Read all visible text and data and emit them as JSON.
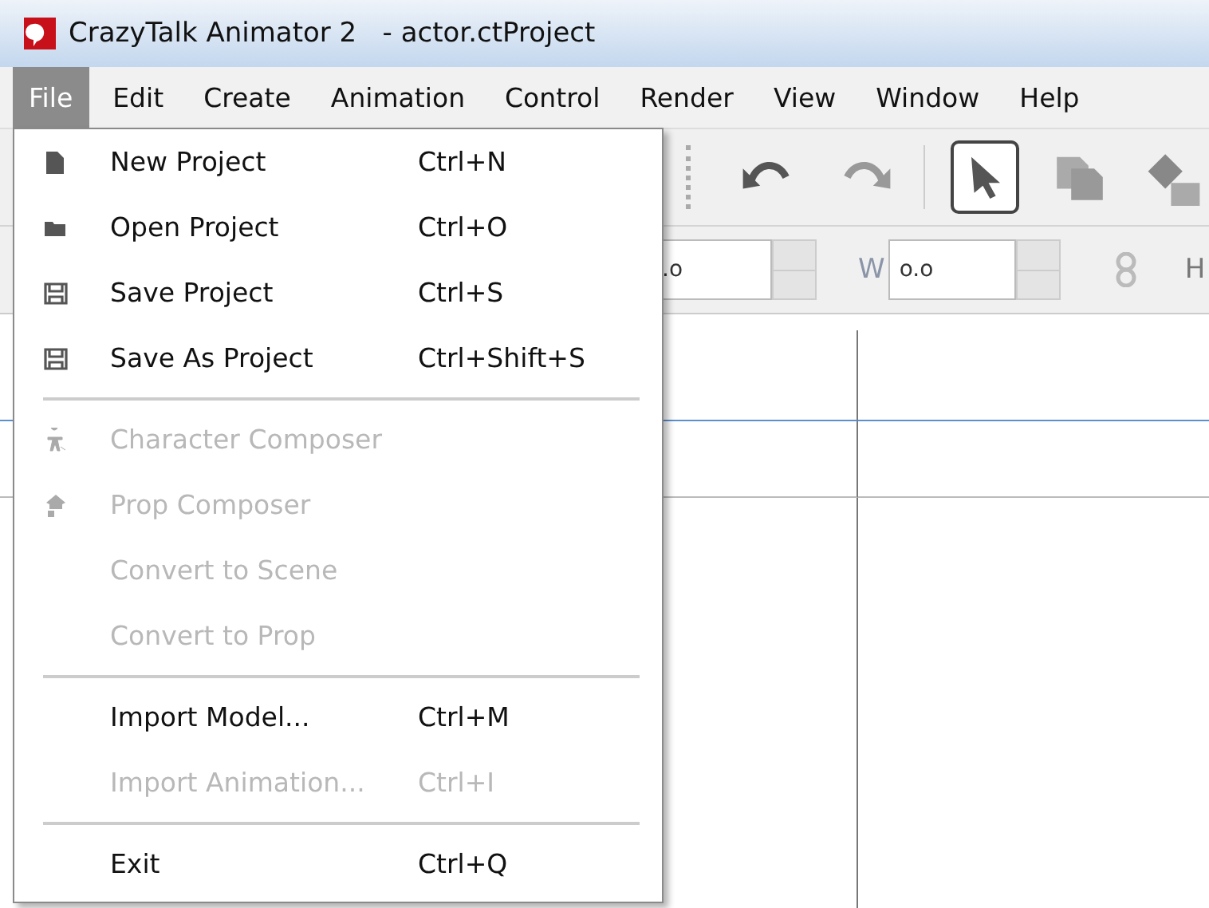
{
  "window": {
    "title": "CrazyTalk Animator 2   - actor.ctProject"
  },
  "menubar": [
    {
      "label": "File",
      "selected": true
    },
    {
      "label": "Edit",
      "selected": false
    },
    {
      "label": "Create",
      "selected": false
    },
    {
      "label": "Animation",
      "selected": false
    },
    {
      "label": "Control",
      "selected": false
    },
    {
      "label": "Render",
      "selected": false
    },
    {
      "label": "View",
      "selected": false
    },
    {
      "label": "Window",
      "selected": false
    },
    {
      "label": "Help",
      "selected": false
    }
  ],
  "toolbar": [
    {
      "kind": "undo",
      "selected": false
    },
    {
      "kind": "redo",
      "selected": false
    },
    {
      "kind": "select",
      "selected": true
    },
    {
      "kind": "copy",
      "selected": false
    },
    {
      "kind": "shape",
      "selected": false
    }
  ],
  "transform_bar": {
    "x_value": ".o",
    "w_label": "W",
    "w_value": "o.o",
    "h_label": "H"
  },
  "file_menu": {
    "sections": [
      [
        {
          "label": "New Project",
          "shortcut": "Ctrl+N",
          "kind": "page",
          "disabled": false
        },
        {
          "label": "Open Project",
          "shortcut": "Ctrl+O",
          "kind": "folder",
          "disabled": false
        },
        {
          "label": "Save Project",
          "shortcut": "Ctrl+S",
          "kind": "floppy",
          "disabled": false
        },
        {
          "label": "Save As Project",
          "shortcut": "Ctrl+Shift+S",
          "kind": "floppy",
          "disabled": false
        }
      ],
      [
        {
          "label": "Character Composer",
          "kind": "figure",
          "disabled": true
        },
        {
          "label": "Prop Composer",
          "kind": "prop",
          "disabled": true
        },
        {
          "label": "Convert to Scene",
          "kind": "plain",
          "disabled": true
        },
        {
          "label": "Convert to Prop",
          "kind": "plain",
          "disabled": true
        }
      ],
      [
        {
          "label": "Import Model...",
          "shortcut": "Ctrl+M",
          "kind": "plain",
          "disabled": false
        },
        {
          "label": "Import Animation...",
          "shortcut": "Ctrl+I",
          "kind": "plain",
          "disabled": true
        }
      ],
      [
        {
          "label": "Exit",
          "shortcut": "Ctrl+Q",
          "kind": "plain",
          "disabled": false
        }
      ]
    ]
  }
}
